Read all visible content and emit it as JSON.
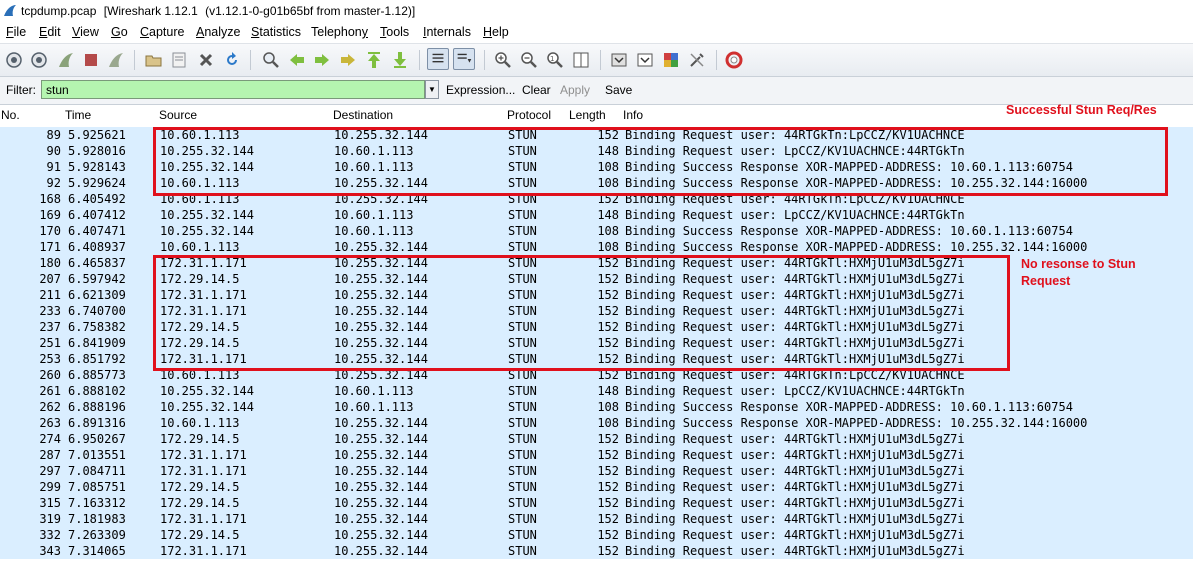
{
  "window": {
    "file_title": "tcpdump.pcap",
    "app_title": "[Wireshark 1.12.1",
    "app_version": "(v1.12.1-0-g01b65bf from master-1.12)]"
  },
  "menu": [
    {
      "label": "File",
      "key": "F"
    },
    {
      "label": "Edit",
      "key": "E"
    },
    {
      "label": "View",
      "key": "V"
    },
    {
      "label": "Go",
      "key": "G"
    },
    {
      "label": "Capture",
      "key": "C"
    },
    {
      "label": "Analyze",
      "key": "A"
    },
    {
      "label": "Statistics",
      "key": "S"
    },
    {
      "label": "Telephony",
      "key": "y"
    },
    {
      "label": "Tools",
      "key": "T"
    },
    {
      "label": "Internals",
      "key": "I"
    },
    {
      "label": "Help",
      "key": "H"
    }
  ],
  "toolbar": {
    "icons": [
      "interface-list-icon",
      "capture-options-icon",
      "start-capture-icon",
      "stop-capture-icon",
      "restart-capture-icon",
      "open-file-icon",
      "save-file-icon",
      "close-file-icon",
      "reload-icon",
      "find-packet-icon",
      "go-back-icon",
      "go-forward-icon",
      "go-to-packet-icon",
      "go-first-icon",
      "go-last-icon",
      "colorize-icon",
      "auto-scroll-icon",
      "zoom-in-icon",
      "zoom-out-icon",
      "zoom-normal-icon",
      "resize-columns-icon",
      "capture-filters-icon",
      "display-filters-icon",
      "coloring-rules-icon",
      "preferences-icon",
      "help-icon"
    ]
  },
  "filter": {
    "label": "Filter:",
    "value": "stun",
    "expression": "Expression...",
    "clear": "Clear",
    "apply": "Apply",
    "save": "Save"
  },
  "columns": {
    "no": "No.",
    "time": "Time",
    "source": "Source",
    "destination": "Destination",
    "protocol": "Protocol",
    "length": "Length",
    "info": "Info"
  },
  "packets": [
    {
      "no": "89",
      "time": "5.925621",
      "src": "10.60.1.113",
      "dst": "10.255.32.144",
      "proto": "STUN",
      "len": "152",
      "info": "Binding Request user: 44RTGkTn:LpCCZ/KV1UACHNCE"
    },
    {
      "no": "90",
      "time": "5.928016",
      "src": "10.255.32.144",
      "dst": "10.60.1.113",
      "proto": "STUN",
      "len": "148",
      "info": "Binding Request user: LpCCZ/KV1UACHNCE:44RTGkTn"
    },
    {
      "no": "91",
      "time": "5.928143",
      "src": "10.255.32.144",
      "dst": "10.60.1.113",
      "proto": "STUN",
      "len": "108",
      "info": "Binding Success Response XOR-MAPPED-ADDRESS: 10.60.1.113:60754"
    },
    {
      "no": "92",
      "time": "5.929624",
      "src": "10.60.1.113",
      "dst": "10.255.32.144",
      "proto": "STUN",
      "len": "108",
      "info": "Binding Success Response XOR-MAPPED-ADDRESS: 10.255.32.144:16000"
    },
    {
      "no": "168",
      "time": "6.405492",
      "src": "10.60.1.113",
      "dst": "10.255.32.144",
      "proto": "STUN",
      "len": "152",
      "info": "Binding Request user: 44RTGkTn:LpCCZ/KV1UACHNCE"
    },
    {
      "no": "169",
      "time": "6.407412",
      "src": "10.255.32.144",
      "dst": "10.60.1.113",
      "proto": "STUN",
      "len": "148",
      "info": "Binding Request user: LpCCZ/KV1UACHNCE:44RTGkTn"
    },
    {
      "no": "170",
      "time": "6.407471",
      "src": "10.255.32.144",
      "dst": "10.60.1.113",
      "proto": "STUN",
      "len": "108",
      "info": "Binding Success Response XOR-MAPPED-ADDRESS: 10.60.1.113:60754"
    },
    {
      "no": "171",
      "time": "6.408937",
      "src": "10.60.1.113",
      "dst": "10.255.32.144",
      "proto": "STUN",
      "len": "108",
      "info": "Binding Success Response XOR-MAPPED-ADDRESS: 10.255.32.144:16000"
    },
    {
      "no": "180",
      "time": "6.465837",
      "src": "172.31.1.171",
      "dst": "10.255.32.144",
      "proto": "STUN",
      "len": "152",
      "info": "Binding Request user: 44RTGkTl:HXMjU1uM3dL5gZ7i"
    },
    {
      "no": "207",
      "time": "6.597942",
      "src": "172.29.14.5",
      "dst": "10.255.32.144",
      "proto": "STUN",
      "len": "152",
      "info": "Binding Request user: 44RTGkTl:HXMjU1uM3dL5gZ7i"
    },
    {
      "no": "211",
      "time": "6.621309",
      "src": "172.31.1.171",
      "dst": "10.255.32.144",
      "proto": "STUN",
      "len": "152",
      "info": "Binding Request user: 44RTGkTl:HXMjU1uM3dL5gZ7i"
    },
    {
      "no": "233",
      "time": "6.740700",
      "src": "172.31.1.171",
      "dst": "10.255.32.144",
      "proto": "STUN",
      "len": "152",
      "info": "Binding Request user: 44RTGkTl:HXMjU1uM3dL5gZ7i"
    },
    {
      "no": "237",
      "time": "6.758382",
      "src": "172.29.14.5",
      "dst": "10.255.32.144",
      "proto": "STUN",
      "len": "152",
      "info": "Binding Request user: 44RTGkTl:HXMjU1uM3dL5gZ7i"
    },
    {
      "no": "251",
      "time": "6.841909",
      "src": "172.29.14.5",
      "dst": "10.255.32.144",
      "proto": "STUN",
      "len": "152",
      "info": "Binding Request user: 44RTGkTl:HXMjU1uM3dL5gZ7i"
    },
    {
      "no": "253",
      "time": "6.851792",
      "src": "172.31.1.171",
      "dst": "10.255.32.144",
      "proto": "STUN",
      "len": "152",
      "info": "Binding Request user: 44RTGkTl:HXMjU1uM3dL5gZ7i"
    },
    {
      "no": "260",
      "time": "6.885773",
      "src": "10.60.1.113",
      "dst": "10.255.32.144",
      "proto": "STUN",
      "len": "152",
      "info": "Binding Request user: 44RTGkTn:LpCCZ/KV1UACHNCE"
    },
    {
      "no": "261",
      "time": "6.888102",
      "src": "10.255.32.144",
      "dst": "10.60.1.113",
      "proto": "STUN",
      "len": "148",
      "info": "Binding Request user: LpCCZ/KV1UACHNCE:44RTGkTn"
    },
    {
      "no": "262",
      "time": "6.888196",
      "src": "10.255.32.144",
      "dst": "10.60.1.113",
      "proto": "STUN",
      "len": "108",
      "info": "Binding Success Response XOR-MAPPED-ADDRESS: 10.60.1.113:60754"
    },
    {
      "no": "263",
      "time": "6.891316",
      "src": "10.60.1.113",
      "dst": "10.255.32.144",
      "proto": "STUN",
      "len": "108",
      "info": "Binding Success Response XOR-MAPPED-ADDRESS: 10.255.32.144:16000"
    },
    {
      "no": "274",
      "time": "6.950267",
      "src": "172.29.14.5",
      "dst": "10.255.32.144",
      "proto": "STUN",
      "len": "152",
      "info": "Binding Request user: 44RTGkTl:HXMjU1uM3dL5gZ7i"
    },
    {
      "no": "287",
      "time": "7.013551",
      "src": "172.31.1.171",
      "dst": "10.255.32.144",
      "proto": "STUN",
      "len": "152",
      "info": "Binding Request user: 44RTGkTl:HXMjU1uM3dL5gZ7i"
    },
    {
      "no": "297",
      "time": "7.084711",
      "src": "172.31.1.171",
      "dst": "10.255.32.144",
      "proto": "STUN",
      "len": "152",
      "info": "Binding Request user: 44RTGkTl:HXMjU1uM3dL5gZ7i"
    },
    {
      "no": "299",
      "time": "7.085751",
      "src": "172.29.14.5",
      "dst": "10.255.32.144",
      "proto": "STUN",
      "len": "152",
      "info": "Binding Request user: 44RTGkTl:HXMjU1uM3dL5gZ7i"
    },
    {
      "no": "315",
      "time": "7.163312",
      "src": "172.29.14.5",
      "dst": "10.255.32.144",
      "proto": "STUN",
      "len": "152",
      "info": "Binding Request user: 44RTGkTl:HXMjU1uM3dL5gZ7i"
    },
    {
      "no": "319",
      "time": "7.181983",
      "src": "172.31.1.171",
      "dst": "10.255.32.144",
      "proto": "STUN",
      "len": "152",
      "info": "Binding Request user: 44RTGkTl:HXMjU1uM3dL5gZ7i"
    },
    {
      "no": "332",
      "time": "7.263309",
      "src": "172.29.14.5",
      "dst": "10.255.32.144",
      "proto": "STUN",
      "len": "152",
      "info": "Binding Request user: 44RTGkTl:HXMjU1uM3dL5gZ7i"
    },
    {
      "no": "343",
      "time": "7.314065",
      "src": "172.31.1.171",
      "dst": "10.255.32.144",
      "proto": "STUN",
      "len": "152",
      "info": "Binding Request user: 44RTGkTl:HXMjU1uM3dL5gZ7i"
    }
  ],
  "annotations": {
    "success": "Successful Stun Req/Res",
    "noresp_line1": "No resonse to Stun",
    "noresp_line2": "Request",
    "color": "#e0101c"
  },
  "colors": {
    "row_bg": "#daeeff",
    "filter_bg": "#b5f5b0"
  }
}
